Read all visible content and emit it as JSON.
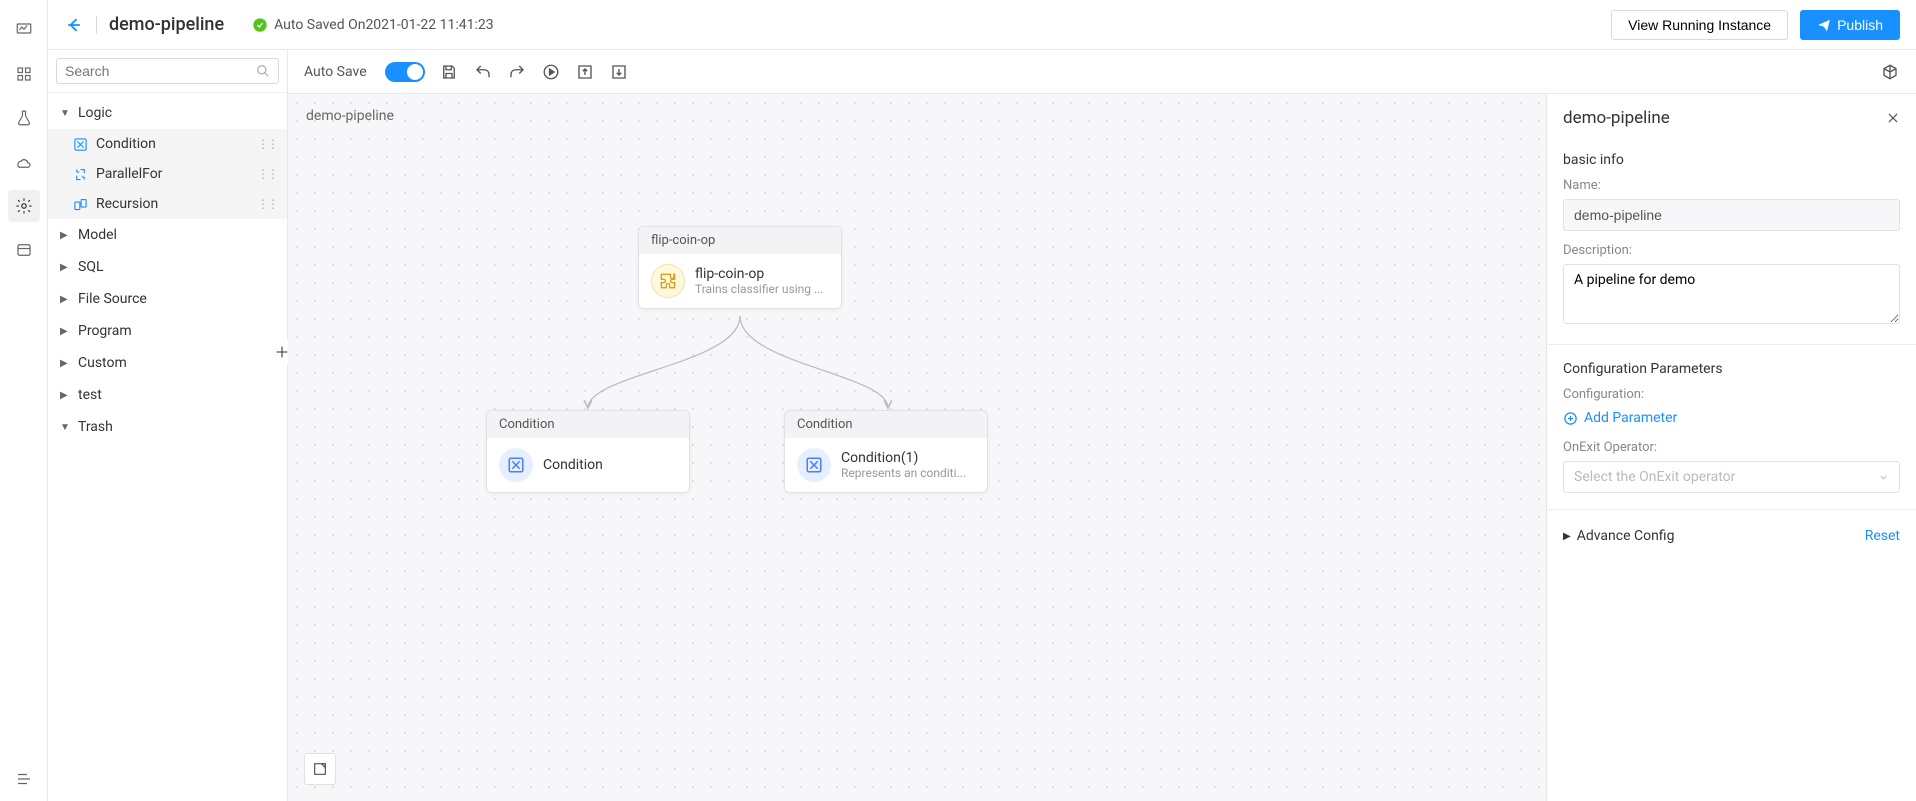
{
  "header": {
    "title": "demo-pipeline",
    "autosave_text": "Auto Saved On2021-01-22 11:41:23",
    "view_instance_label": "View Running Instance",
    "publish_label": "Publish"
  },
  "toolbar": {
    "autosave_label": "Auto Save"
  },
  "sidebar": {
    "search_placeholder": "Search",
    "categories": [
      {
        "label": "Logic",
        "expanded": true
      },
      {
        "label": "Model",
        "expanded": false
      },
      {
        "label": "SQL",
        "expanded": false
      },
      {
        "label": "File Source",
        "expanded": false
      },
      {
        "label": "Program",
        "expanded": false
      },
      {
        "label": "Custom",
        "expanded": false
      },
      {
        "label": "test",
        "expanded": false
      },
      {
        "label": "Trash",
        "expanded": false
      }
    ],
    "logic_items": [
      {
        "label": "Condition"
      },
      {
        "label": "ParallelFor"
      },
      {
        "label": "Recursion"
      }
    ]
  },
  "canvas": {
    "title": "demo-pipeline",
    "nodes": {
      "flip": {
        "head": "flip-coin-op",
        "title": "flip-coin-op",
        "sub": "Trains classifier using ..."
      },
      "cond1": {
        "head": "Condition",
        "title": "Condition",
        "sub": ""
      },
      "cond2": {
        "head": "Condition",
        "title": "Condition(1)",
        "sub": "Represents an conditi..."
      }
    }
  },
  "right_panel": {
    "title": "demo-pipeline",
    "basic_info_label": "basic info",
    "name_label": "Name:",
    "name_value": "demo-pipeline",
    "description_label": "Description:",
    "description_value": "A pipeline for demo",
    "config_params_label": "Configuration Parameters",
    "configuration_label": "Configuration:",
    "add_param_label": "Add Parameter",
    "onexit_label": "OnExit Operator:",
    "onexit_placeholder": "Select the OnExit operator",
    "advance_label": "Advance Config",
    "reset_label": "Reset"
  }
}
